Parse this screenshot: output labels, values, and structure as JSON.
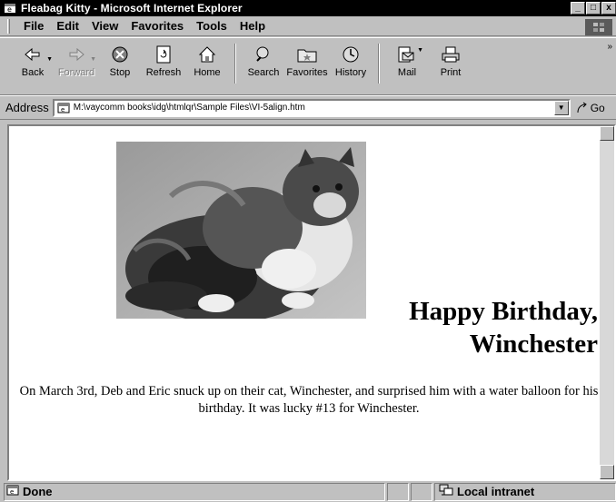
{
  "window": {
    "title": "Fleabag Kitty - Microsoft Internet Explorer",
    "buttons": {
      "minimize": "_",
      "maximize": "□",
      "close": "x"
    }
  },
  "menubar": {
    "items": [
      {
        "label": "File"
      },
      {
        "label": "Edit"
      },
      {
        "label": "View"
      },
      {
        "label": "Favorites"
      },
      {
        "label": "Tools"
      },
      {
        "label": "Help"
      }
    ]
  },
  "toolbar": {
    "back": "Back",
    "forward": "Forward",
    "stop": "Stop",
    "refresh": "Refresh",
    "home": "Home",
    "search": "Search",
    "favorites": "Favorites",
    "history": "History",
    "mail": "Mail",
    "print": "Print"
  },
  "addressbar": {
    "label": "Address",
    "url": "M:\\vaycomm books\\idg\\htmlqr\\Sample Files\\VI-5align.htm",
    "go": "Go"
  },
  "page": {
    "heading_line1": "Happy Birthday,",
    "heading_line2": "Winchester",
    "paragraph": "On March 3rd, Deb and Eric snuck up on their cat, Winchester, and surprised him with a water balloon for his birthday. It was lucky #13 for Winchester."
  },
  "statusbar": {
    "status": "Done",
    "zone": "Local intranet"
  },
  "colors": {
    "chrome": "#c0c0c0",
    "titlebar": "#000000",
    "page_background": "#ffffff"
  }
}
